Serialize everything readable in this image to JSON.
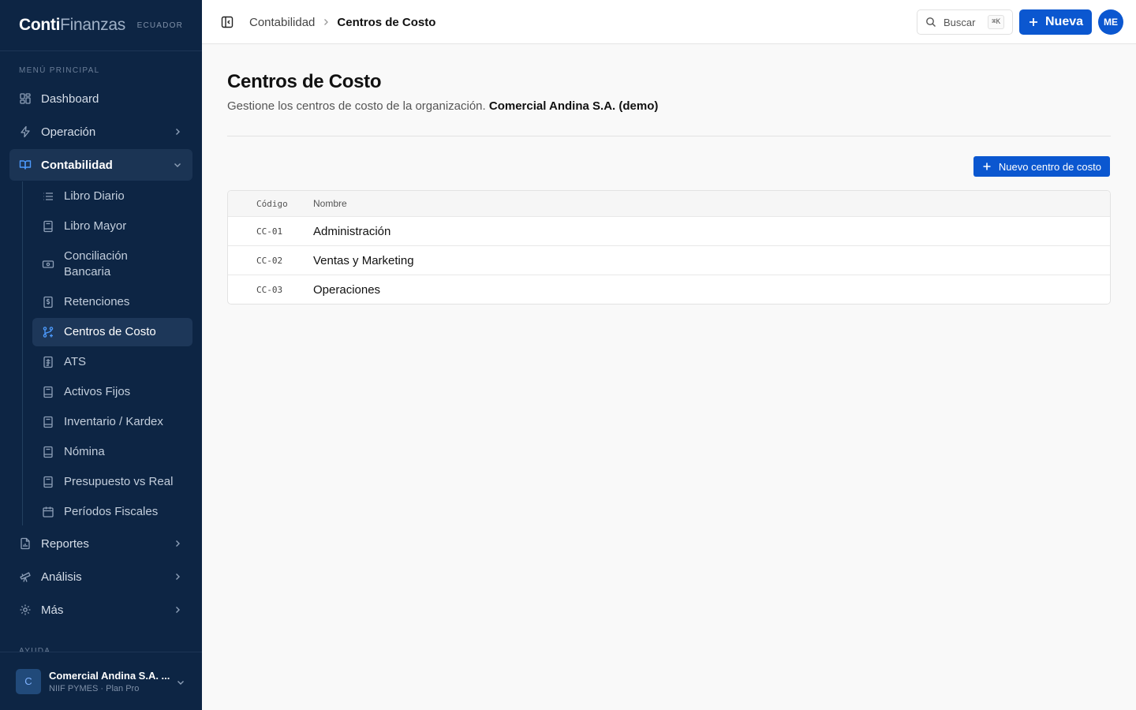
{
  "brand": {
    "name_bold": "Conti",
    "name_light": "Finanzas",
    "country": "ECUADOR"
  },
  "sidebar": {
    "section_main": "MENÚ PRINCIPAL",
    "items": [
      {
        "label": "Dashboard",
        "icon": "dashboard-icon"
      },
      {
        "label": "Operación",
        "icon": "bolt-icon"
      },
      {
        "label": "Contabilidad",
        "icon": "book-icon",
        "expanded": true
      },
      {
        "label": "Reportes",
        "icon": "report-icon"
      },
      {
        "label": "Análisis",
        "icon": "telescope-icon"
      },
      {
        "label": "Más",
        "icon": "gear-icon"
      }
    ],
    "subitems": [
      {
        "label": "Libro Diario",
        "icon": "list-icon"
      },
      {
        "label": "Libro Mayor",
        "icon": "ledger-icon"
      },
      {
        "label": "Conciliación Bancaria",
        "icon": "bank-icon"
      },
      {
        "label": "Retenciones",
        "icon": "receipt-icon"
      },
      {
        "label": "Centros de Costo",
        "icon": "branches-icon",
        "active": true
      },
      {
        "label": "ATS",
        "icon": "spreadsheet-icon"
      },
      {
        "label": "Activos Fijos",
        "icon": "ledger-icon"
      },
      {
        "label": "Inventario / Kardex",
        "icon": "ledger-icon"
      },
      {
        "label": "Nómina",
        "icon": "ledger-icon"
      },
      {
        "label": "Presupuesto vs Real",
        "icon": "ledger-icon"
      },
      {
        "label": "Períodos Fiscales",
        "icon": "calendar-icon"
      }
    ],
    "section_help": "AYUDA",
    "org": {
      "initial": "C",
      "name": "Comercial Andina S.A. ...",
      "plan": "NIIF PYMES · Plan Pro"
    }
  },
  "topbar": {
    "breadcrumb_parent": "Contabilidad",
    "breadcrumb_current": "Centros de Costo",
    "search_label": "Buscar",
    "search_shortcut": "⌘K",
    "new_label": "Nueva",
    "avatar_initials": "ME"
  },
  "page": {
    "title": "Centros de Costo",
    "subtitle": "Gestione los centros de costo de la organización.",
    "org_name": "Comercial Andina S.A. (demo)",
    "add_button": "Nuevo centro de costo"
  },
  "table": {
    "columns": [
      "Código",
      "Nombre"
    ],
    "rows": [
      {
        "code": "CC-01",
        "name": "Administración"
      },
      {
        "code": "CC-02",
        "name": "Ventas y Marketing"
      },
      {
        "code": "CC-03",
        "name": "Operaciones"
      }
    ]
  },
  "colors": {
    "sidebar_bg": "#0d2544",
    "accent": "#0b57d0",
    "active_icon": "#4d9bff"
  }
}
